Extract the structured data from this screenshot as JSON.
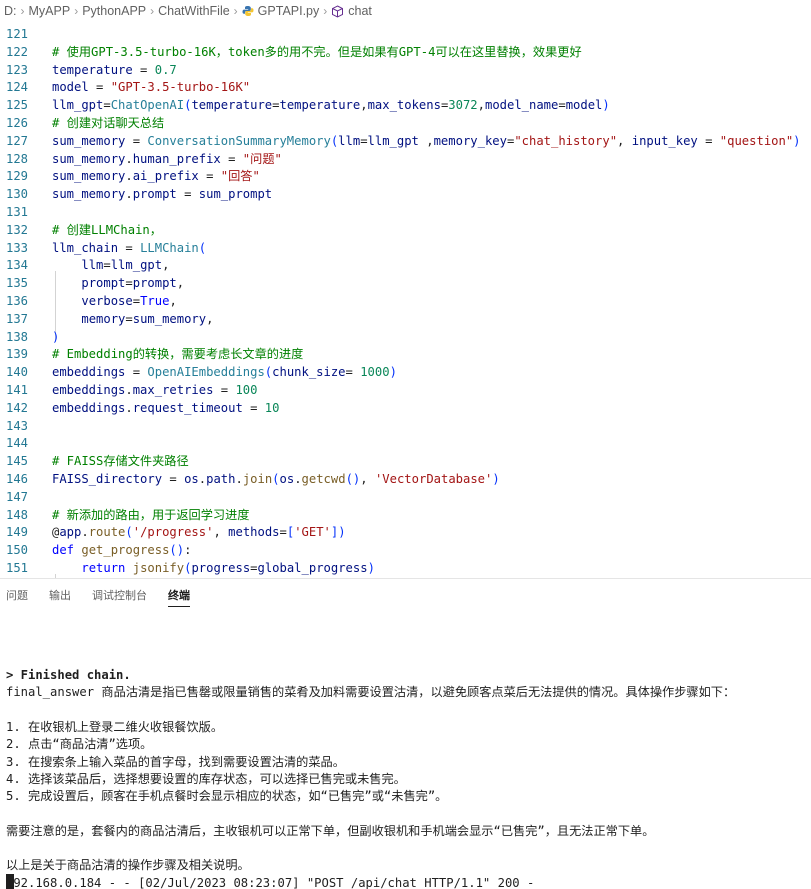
{
  "breadcrumb": {
    "drive": "D:",
    "items": [
      "MyAPP",
      "PythonAPP",
      "ChatWithFile",
      "GPTAPI.py",
      "chat"
    ]
  },
  "editor": {
    "lines": [
      {
        "n": "121",
        "t": []
      },
      {
        "n": "122",
        "t": [
          [
            "cmt",
            "# 使用GPT-3.5-turbo-16K，token多的用不完。但是如果有GPT-4可以在这里替换，效果更好"
          ]
        ]
      },
      {
        "n": "123",
        "t": [
          [
            "var",
            "temperature"
          ],
          [
            "op",
            " = "
          ],
          [
            "num",
            "0.7"
          ]
        ]
      },
      {
        "n": "124",
        "t": [
          [
            "var",
            "model"
          ],
          [
            "op",
            " = "
          ],
          [
            "str",
            "\"GPT-3.5-turbo-16K\""
          ]
        ]
      },
      {
        "n": "125",
        "t": [
          [
            "var",
            "llm_gpt"
          ],
          [
            "op",
            "="
          ],
          [
            "cls",
            "ChatOpenAI"
          ],
          [
            "par",
            "("
          ],
          [
            "var",
            "temperature"
          ],
          [
            "op",
            "="
          ],
          [
            "var",
            "temperature"
          ],
          [
            "op",
            ","
          ],
          [
            "var",
            "max_tokens"
          ],
          [
            "op",
            "="
          ],
          [
            "num",
            "3072"
          ],
          [
            "op",
            ","
          ],
          [
            "var",
            "model_name"
          ],
          [
            "op",
            "="
          ],
          [
            "var",
            "model"
          ],
          [
            "par",
            ")"
          ]
        ]
      },
      {
        "n": "126",
        "t": [
          [
            "cmt",
            "# 创建对话聊天总结"
          ]
        ]
      },
      {
        "n": "127",
        "t": [
          [
            "var",
            "sum_memory"
          ],
          [
            "op",
            " = "
          ],
          [
            "cls",
            "ConversationSummaryMemory"
          ],
          [
            "par",
            "("
          ],
          [
            "var",
            "llm"
          ],
          [
            "op",
            "="
          ],
          [
            "var",
            "llm_gpt"
          ],
          [
            "op",
            " ,"
          ],
          [
            "var",
            "memory_key"
          ],
          [
            "op",
            "="
          ],
          [
            "str",
            "\"chat_history\""
          ],
          [
            "op",
            ", "
          ],
          [
            "var",
            "input_key"
          ],
          [
            "op",
            " = "
          ],
          [
            "str",
            "\"question\""
          ],
          [
            "par",
            ")"
          ]
        ]
      },
      {
        "n": "128",
        "t": [
          [
            "var",
            "sum_memory"
          ],
          [
            "op",
            "."
          ],
          [
            "var",
            "human_prefix"
          ],
          [
            "op",
            " = "
          ],
          [
            "str",
            "\"问题\""
          ]
        ]
      },
      {
        "n": "129",
        "t": [
          [
            "var",
            "sum_memory"
          ],
          [
            "op",
            "."
          ],
          [
            "var",
            "ai_prefix"
          ],
          [
            "op",
            " = "
          ],
          [
            "str",
            "\"回答\""
          ]
        ]
      },
      {
        "n": "130",
        "t": [
          [
            "var",
            "sum_memory"
          ],
          [
            "op",
            "."
          ],
          [
            "var",
            "prompt"
          ],
          [
            "op",
            " = "
          ],
          [
            "var",
            "sum_prompt"
          ]
        ]
      },
      {
        "n": "131",
        "t": []
      },
      {
        "n": "132",
        "t": [
          [
            "cmt",
            "# 创建LLMChain，"
          ]
        ]
      },
      {
        "n": "133",
        "t": [
          [
            "var",
            "llm_chain"
          ],
          [
            "op",
            " = "
          ],
          [
            "cls",
            "LLMChain"
          ],
          [
            "par",
            "("
          ]
        ]
      },
      {
        "n": "134",
        "t": [
          [
            "op",
            "    "
          ],
          [
            "var",
            "llm"
          ],
          [
            "op",
            "="
          ],
          [
            "var",
            "llm_gpt"
          ],
          [
            "op",
            ","
          ]
        ]
      },
      {
        "n": "135",
        "t": [
          [
            "op",
            "    "
          ],
          [
            "var",
            "prompt"
          ],
          [
            "op",
            "="
          ],
          [
            "var",
            "prompt"
          ],
          [
            "op",
            ","
          ]
        ]
      },
      {
        "n": "136",
        "t": [
          [
            "op",
            "    "
          ],
          [
            "var",
            "verbose"
          ],
          [
            "op",
            "="
          ],
          [
            "kw",
            "True"
          ],
          [
            "op",
            ","
          ]
        ]
      },
      {
        "n": "137",
        "t": [
          [
            "op",
            "    "
          ],
          [
            "var",
            "memory"
          ],
          [
            "op",
            "="
          ],
          [
            "var",
            "sum_memory"
          ],
          [
            "op",
            ","
          ]
        ]
      },
      {
        "n": "138",
        "t": [
          [
            "par",
            ")"
          ]
        ]
      },
      {
        "n": "139",
        "t": [
          [
            "cmt",
            "# Embedding的转换，需要考虑长文章的进度"
          ]
        ]
      },
      {
        "n": "140",
        "t": [
          [
            "var",
            "embeddings"
          ],
          [
            "op",
            " = "
          ],
          [
            "cls",
            "OpenAIEmbeddings"
          ],
          [
            "par",
            "("
          ],
          [
            "var",
            "chunk_size"
          ],
          [
            "op",
            "= "
          ],
          [
            "num",
            "1000"
          ],
          [
            "par",
            ")"
          ]
        ]
      },
      {
        "n": "141",
        "t": [
          [
            "var",
            "embeddings"
          ],
          [
            "op",
            "."
          ],
          [
            "var",
            "max_retries"
          ],
          [
            "op",
            " = "
          ],
          [
            "num",
            "100"
          ]
        ]
      },
      {
        "n": "142",
        "t": [
          [
            "var",
            "embeddings"
          ],
          [
            "op",
            "."
          ],
          [
            "var",
            "request_timeout"
          ],
          [
            "op",
            " = "
          ],
          [
            "num",
            "10"
          ]
        ]
      },
      {
        "n": "143",
        "t": []
      },
      {
        "n": "144",
        "t": []
      },
      {
        "n": "145",
        "t": [
          [
            "cmt",
            "# FAISS存储文件夹路径"
          ]
        ]
      },
      {
        "n": "146",
        "t": [
          [
            "var",
            "FAISS_directory"
          ],
          [
            "op",
            " = "
          ],
          [
            "var",
            "os"
          ],
          [
            "op",
            "."
          ],
          [
            "var",
            "path"
          ],
          [
            "op",
            "."
          ],
          [
            "fn",
            "join"
          ],
          [
            "par",
            "("
          ],
          [
            "var",
            "os"
          ],
          [
            "op",
            "."
          ],
          [
            "fn",
            "getcwd"
          ],
          [
            "par",
            "()"
          ],
          [
            "op",
            ", "
          ],
          [
            "str",
            "'VectorDatabase'"
          ],
          [
            "par",
            ")"
          ]
        ]
      },
      {
        "n": "147",
        "t": []
      },
      {
        "n": "148",
        "t": [
          [
            "cmt",
            "# 新添加的路由，用于返回学习进度"
          ]
        ]
      },
      {
        "n": "149",
        "t": [
          [
            "op",
            "@"
          ],
          [
            "var",
            "app"
          ],
          [
            "op",
            "."
          ],
          [
            "fn",
            "route"
          ],
          [
            "par",
            "("
          ],
          [
            "str",
            "'/progress'"
          ],
          [
            "op",
            ", "
          ],
          [
            "var",
            "methods"
          ],
          [
            "op",
            "="
          ],
          [
            "par",
            "["
          ],
          [
            "str",
            "'GET'"
          ],
          [
            "par",
            "]"
          ],
          [
            "par",
            ")"
          ]
        ]
      },
      {
        "n": "150",
        "t": [
          [
            "kw",
            "def"
          ],
          [
            "op",
            " "
          ],
          [
            "fn",
            "get_progress"
          ],
          [
            "par",
            "()"
          ],
          [
            "op",
            ":"
          ]
        ]
      },
      {
        "n": "151",
        "t": [
          [
            "op",
            "    "
          ],
          [
            "kw",
            "return"
          ],
          [
            "op",
            " "
          ],
          [
            "fn",
            "jsonify"
          ],
          [
            "par",
            "("
          ],
          [
            "var",
            "progress"
          ],
          [
            "op",
            "="
          ],
          [
            "var",
            "global_progress"
          ],
          [
            "par",
            ")"
          ]
        ]
      }
    ]
  },
  "panel": {
    "tabs": [
      "问题",
      "输出",
      "调试控制台",
      "终端"
    ],
    "active_tab": "终端"
  },
  "terminal": {
    "lines": [
      "> Finished chain.",
      "final_answer 商品沽清是指已售罄或限量销售的菜肴及加料需要设置沽清，以避免顾客点菜后无法提供的情况。具体操作步骤如下：",
      "",
      "1. 在收银机上登录二维火收银餐饮版。",
      "2. 点击“商品沽清”选项。",
      "3. 在搜索条上输入菜品的首字母，找到需要设置沽清的菜品。",
      "4. 选择该菜品后，选择想要设置的库存状态，可以选择已售完或未售完。",
      "5. 完成设置后，顾客在手机点餐时会显示相应的状态，如“已售完”或“未售完”。",
      "",
      "需要注意的是，套餐内的商品沽清后，主收银机可以正常下单，但副收银机和手机端会显示“已售完”，且无法正常下单。",
      "",
      "以上是关于商品沽清的操作步骤及相关说明。",
      "192.168.0.184 - - [02/Jul/2023 08:23:07] \"POST /api/chat HTTP/1.1\" 200 -"
    ]
  }
}
